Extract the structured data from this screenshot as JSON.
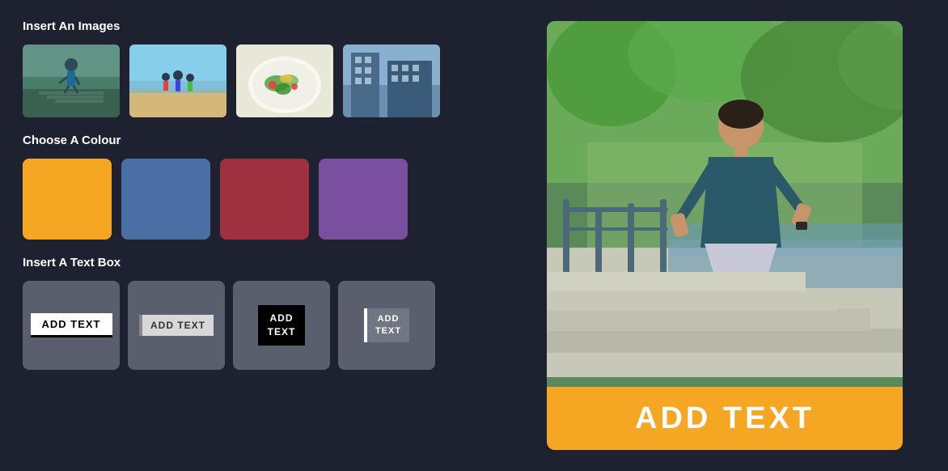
{
  "leftPanel": {
    "imagesSection": {
      "title": "Insert An Images",
      "images": [
        {
          "id": "img-runner",
          "alt": "Runner on stairs",
          "style": "runner"
        },
        {
          "id": "img-beach",
          "alt": "People at beach",
          "style": "beach"
        },
        {
          "id": "img-salad",
          "alt": "Salad dish",
          "style": "salad"
        },
        {
          "id": "img-building",
          "alt": "Buildings architecture",
          "style": "building"
        }
      ]
    },
    "coloursSection": {
      "title": "Choose A Colour",
      "colours": [
        {
          "id": "orange",
          "hex": "#f5a623",
          "label": "Orange"
        },
        {
          "id": "blue",
          "hex": "#4a6fa5",
          "label": "Blue"
        },
        {
          "id": "red",
          "hex": "#9e3040",
          "label": "Red"
        },
        {
          "id": "purple",
          "hex": "#7b4fa0",
          "label": "Purple"
        }
      ]
    },
    "textboxSection": {
      "title": "Insert A Text Box",
      "options": [
        {
          "id": "tb1",
          "label": "ADD TEXT",
          "style": "white-underline"
        },
        {
          "id": "tb2",
          "label": "ADD TEXT",
          "style": "grey-border"
        },
        {
          "id": "tb3",
          "label": "ADD\nTEXT",
          "style": "black-bg"
        },
        {
          "id": "tb4",
          "label": "ADD\nTEXT",
          "style": "white-border"
        }
      ]
    }
  },
  "rightPanel": {
    "preview": {
      "overlayText": "ADD TEXT",
      "overlayBgColor": "#f5a623"
    }
  }
}
